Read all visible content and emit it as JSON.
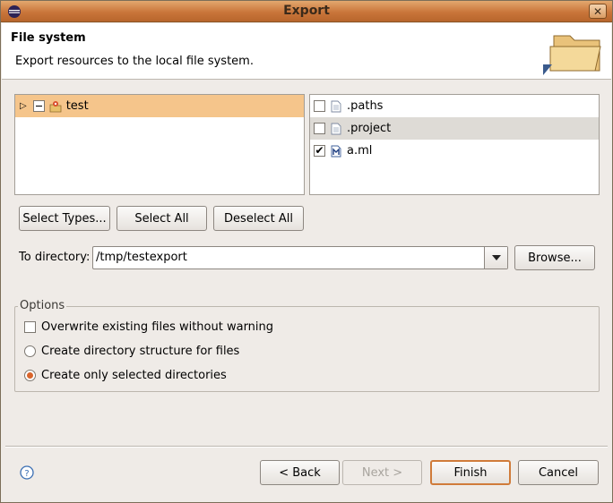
{
  "window": {
    "title": "Export"
  },
  "header": {
    "title": "File system",
    "description": "Export resources to the local file system."
  },
  "tree": {
    "items": [
      {
        "label": "test",
        "checkbox": "partial",
        "selected": true
      }
    ]
  },
  "files": {
    "items": [
      {
        "label": ".paths",
        "checked": false
      },
      {
        "label": ".project",
        "checked": false
      },
      {
        "label": "a.ml",
        "checked": true
      }
    ]
  },
  "buttons": {
    "select_types": "Select Types...",
    "select_all": "Select All",
    "deselect_all": "Deselect All",
    "browse": "Browse...",
    "back": "< Back",
    "next": "Next >",
    "finish": "Finish",
    "cancel": "Cancel"
  },
  "directory": {
    "label": "To directory:",
    "value": "/tmp/testexport"
  },
  "options": {
    "group_label": "Options",
    "overwrite": {
      "label": "Overwrite existing files without warning",
      "checked": false
    },
    "create_structure": {
      "label": "Create directory structure for files",
      "selected": false
    },
    "create_selected": {
      "label": "Create only selected directories",
      "selected": true
    }
  },
  "colors": {
    "accent": "#d9652c",
    "selection": "#f5c58b",
    "titlebar": "#c9753a"
  },
  "icons": {
    "help": "help-icon",
    "project": "project-icon",
    "file": "file-icon",
    "ml_file": "ml-file-icon"
  }
}
